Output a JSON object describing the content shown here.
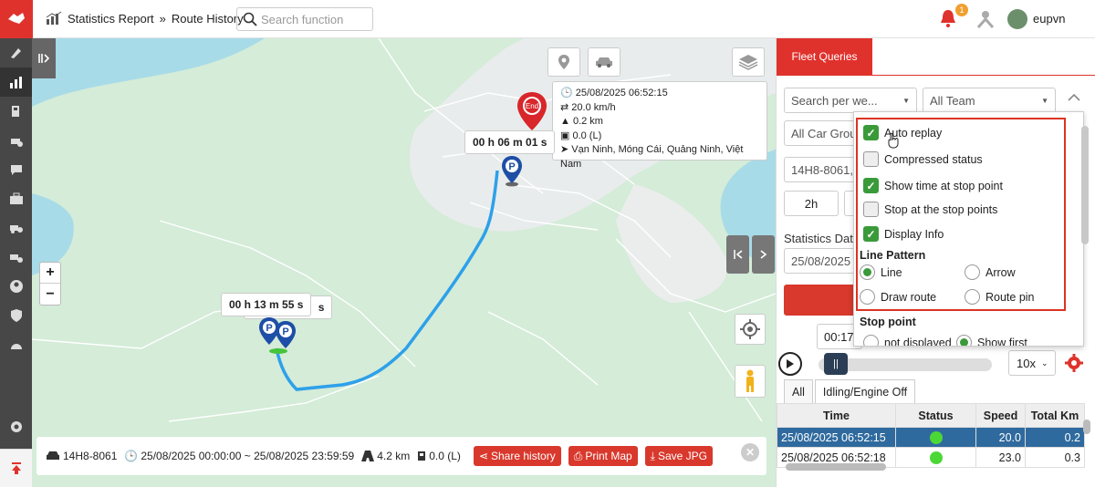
{
  "header": {
    "breadcrumb": [
      "Statistics Report",
      "Route History"
    ],
    "breadcrumb_sep": "»",
    "search_placeholder": "Search function",
    "notification_count": "1",
    "username": "eupvn"
  },
  "map": {
    "info_popup": {
      "time": "25/08/2025 06:52:15",
      "speed": "20.0 km/h",
      "distance": "0.2 km",
      "fuel": "0.0 (L)",
      "address": "Vạn Ninh, Móng Cái, Quảng Ninh, Việt Nam"
    },
    "end_label": "End",
    "stop_duration_1": "00 h 06 m 01 s",
    "stop_duration_2": "00 h 13 m 55 s",
    "stop_duration_2_behind": "s",
    "zoom_in": "+",
    "zoom_out": "−",
    "bottom": {
      "vehicle": "14H8-8061",
      "time_range": "25/08/2025 00:00:00 ~ 25/08/2025 23:59:59",
      "distance": "4.2 km",
      "fuel": "0.0 (L)",
      "share_label": "Share history",
      "print_label": "Print Map",
      "save_label": "Save JPG"
    }
  },
  "panel": {
    "tab_title": "Fleet Queries",
    "search_week": "Search per we...",
    "team": "All Team",
    "car_group": "All Car Grou",
    "vehicle": "14H8-8061,",
    "hours_btn": "2h",
    "statistics_date_label": "Statistics Date",
    "date_value": "25/08/2025",
    "time_value": "00:17",
    "options": {
      "auto_replay": "Auto replay",
      "compressed_status": "Compressed status",
      "show_time_stop": "Show time at stop point",
      "stop_at_stop": "Stop at the stop points",
      "display_info": "Display Info",
      "line_pattern_title": "Line Pattern",
      "line": "Line",
      "arrow": "Arrow",
      "draw_route": "Draw route",
      "route_pin": "Route pin",
      "stop_point_title": "Stop point",
      "not_displayed": "not displayed",
      "show_first": "Show first"
    },
    "playback_speed": "10x",
    "tabs": [
      "All",
      "Idling/Engine Off"
    ],
    "table": {
      "headers": [
        "Time",
        "Status",
        "Speed",
        "Total Km"
      ],
      "rows": [
        {
          "time": "25/08/2025 06:52:15",
          "speed": "20.0",
          "km": "0.2"
        },
        {
          "time": "25/08/2025 06:52:18",
          "speed": "23.0",
          "km": "0.3"
        }
      ]
    }
  }
}
